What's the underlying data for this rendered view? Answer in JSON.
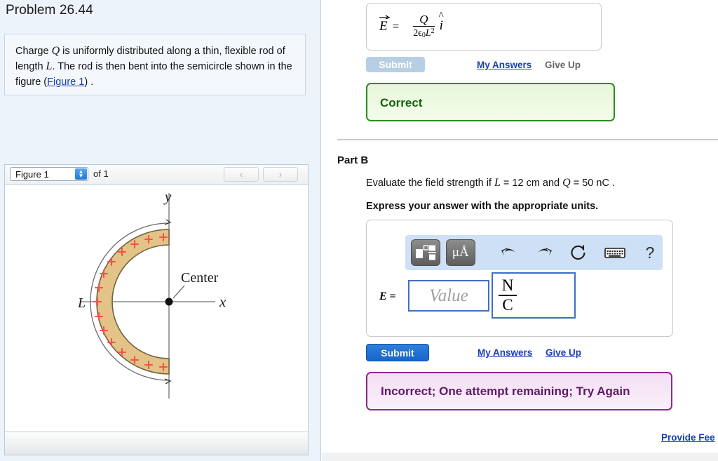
{
  "problem": {
    "title": "Problem 26.44",
    "statement_parts": {
      "t1": "Charge ",
      "v1": "Q",
      "t2": " is uniformly distributed along a thin, flexible rod of length ",
      "v2": "L",
      "t3": ". The rod is then bent into the semicircle shown in the figure (",
      "link": "Figure 1",
      "t4": ") ."
    }
  },
  "figure_viewer": {
    "selected": "Figure 1",
    "of_label": "of 1",
    "prev_icon": "chevron-left-icon",
    "next_icon": "chevron-right-icon",
    "diagram": {
      "y_axis_label": "y",
      "x_axis_label": "x",
      "center_label": "Center",
      "length_label": "L",
      "charge_symbol": "+",
      "band_fill": "#e3c387",
      "band_stroke": "#6f6340",
      "charge_color": "#f0544a",
      "axis_color": "#8c8c8c"
    }
  },
  "part_a": {
    "equation": {
      "lhs": "E",
      "equals": "=",
      "numerator": "Q",
      "denominator_prefix": "2",
      "denominator_eps": "ϵ",
      "denominator_eps_sub": "0",
      "denominator_L": "L",
      "denominator_L_sup": "2",
      "unit_vector": "i"
    },
    "submit_label": "Submit",
    "my_answers_label": "My Answers",
    "give_up_label": "Give Up",
    "feedback": "Correct",
    "feedback_color": "#16640b"
  },
  "part_b": {
    "heading": "Part B",
    "question_parts": {
      "t1": "Evaluate the field strength if ",
      "v1": "L",
      "t2": " = 12 cm and ",
      "v2": "Q",
      "t3": " = 50 nC ."
    },
    "instruction": "Express your answer with the appropriate units.",
    "toolbar": [
      {
        "name": "math-template-icon",
        "label": ""
      },
      {
        "name": "units-icon",
        "label": "μÅ"
      },
      {
        "name": "undo-icon",
        "label": ""
      },
      {
        "name": "redo-icon",
        "label": ""
      },
      {
        "name": "reset-icon",
        "label": ""
      },
      {
        "name": "keyboard-icon",
        "label": ""
      },
      {
        "name": "help-icon",
        "label": "?"
      }
    ],
    "answer_label": "E",
    "answer_equals": "=",
    "value_placeholder": "Value",
    "unit_numerator": "N",
    "unit_denominator": "C",
    "submit_label": "Submit",
    "my_answers_label": "My Answers",
    "give_up_label": "Give Up",
    "feedback": "Incorrect; One attempt remaining; Try Again",
    "feedback_color": "#5e1a66"
  },
  "footer": {
    "provide_feedback": "Provide Fee"
  }
}
